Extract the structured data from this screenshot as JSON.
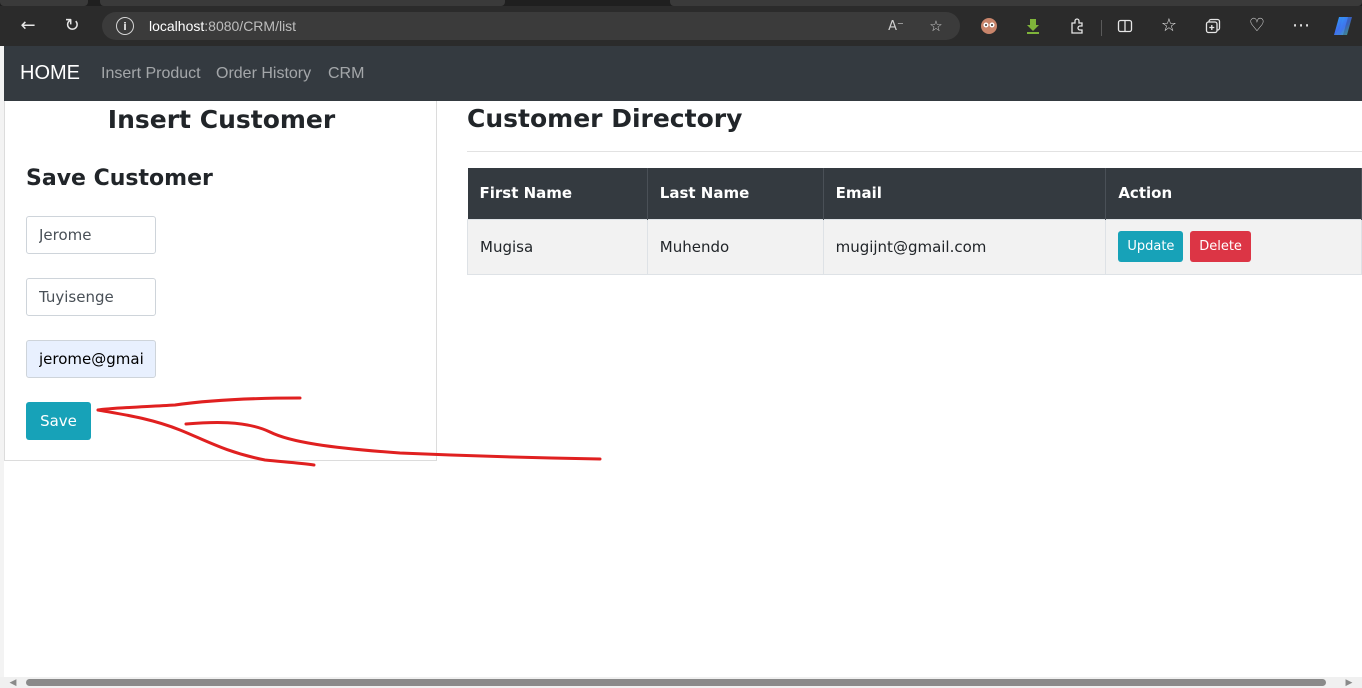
{
  "browser": {
    "url_host": "localhost",
    "url_path": ":8080/CRM/list",
    "icons": {
      "back": "back-arrow-icon",
      "reload": "reload-icon",
      "info": "site-info-icon",
      "read_aloud": "read-aloud-icon",
      "favorite": "favorite-star-icon",
      "extensions": "extensions-icon",
      "split": "split-screen-icon",
      "favorites": "favorites-icon",
      "collections": "collections-icon",
      "health": "browser-essentials-icon",
      "more": "more-icon",
      "copilot": "copilot-icon"
    }
  },
  "nav": {
    "brand": "HOME",
    "links": [
      "Insert Product",
      "Order History",
      "CRM"
    ]
  },
  "insert_form": {
    "card_title": "Insert Customer",
    "form_title": "Save Customer",
    "first_name_value": "Jerome",
    "last_name_value": "Tuyisenge",
    "email_value": "jerome@gmail",
    "save_label": "Save"
  },
  "directory": {
    "title": "Customer Directory",
    "columns": [
      "First Name",
      "Last Name",
      "Email",
      "Action"
    ],
    "rows": [
      {
        "first_name": "Mugisa",
        "last_name": "Muhendo",
        "email": "mugijnt@gmail.com",
        "update_label": "Update",
        "delete_label": "Delete"
      }
    ]
  },
  "colors": {
    "navbar": "#343a40",
    "info_button": "#17a2b8",
    "danger_button": "#dc3545",
    "annotation": "#e02020"
  }
}
